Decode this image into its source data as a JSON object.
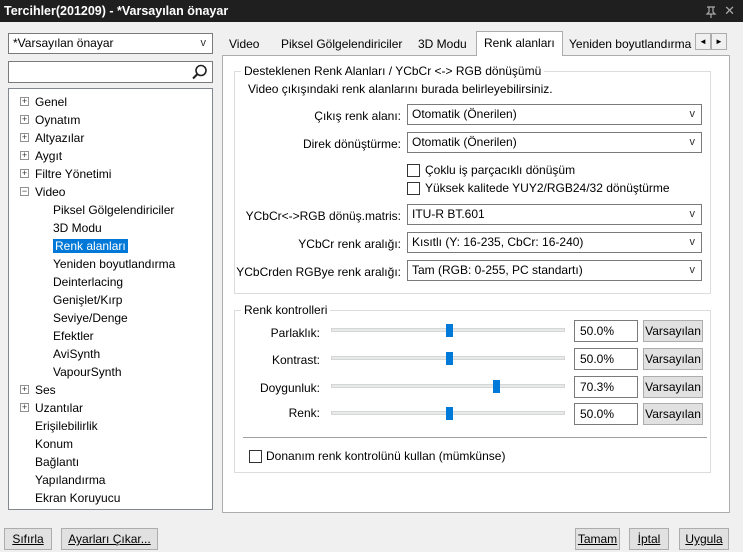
{
  "window": {
    "title": "Tercihler(201209) - *Varsayılan önayar",
    "pin_icon": "pin-icon",
    "close_icon": "close-icon"
  },
  "preset": {
    "value": "*Varsayılan önayar"
  },
  "search": {
    "value": "",
    "placeholder": ""
  },
  "tree": {
    "items": [
      {
        "label": "Genel",
        "expander": "+"
      },
      {
        "label": "Oynatım",
        "expander": "+"
      },
      {
        "label": "Altyazılar",
        "expander": "+"
      },
      {
        "label": "Aygıt",
        "expander": "+"
      },
      {
        "label": "Filtre Yönetimi",
        "expander": "+"
      },
      {
        "label": "Video",
        "expander": "−"
      },
      {
        "label": "Piksel Gölgelendiriciler"
      },
      {
        "label": "3D Modu"
      },
      {
        "label": "Renk alanları"
      },
      {
        "label": "Yeniden boyutlandırma"
      },
      {
        "label": "Deinterlacing"
      },
      {
        "label": "Genişlet/Kırp"
      },
      {
        "label": "Seviye/Denge"
      },
      {
        "label": "Efektler"
      },
      {
        "label": "AviSynth"
      },
      {
        "label": "VapourSynth"
      },
      {
        "label": "Ses",
        "expander": "+"
      },
      {
        "label": "Uzantılar",
        "expander": "+"
      },
      {
        "label": "Erişilebilirlik"
      },
      {
        "label": "Konum"
      },
      {
        "label": "Bağlantı"
      },
      {
        "label": "Yapılandırma"
      },
      {
        "label": "Ekran Koruyucu"
      }
    ],
    "selected": "Renk alanları"
  },
  "tabs": [
    {
      "label": "Video"
    },
    {
      "label": "Piksel Gölgelendiriciler"
    },
    {
      "label": "3D Modu"
    },
    {
      "label": "Renk alanları"
    },
    {
      "label": "Yeniden boyutlandırma"
    }
  ],
  "tab_scroll": {
    "left": "◄",
    "right": "►"
  },
  "colorspace": {
    "title": "Desteklenen Renk Alanları / YCbCr <-> RGB dönüşümü",
    "description": "Video çıkışındaki renk alanlarını burada belirleyebilirsiniz.",
    "output_label": "Çıkış renk alanı:",
    "output_value": "Otomatik (Önerilen)",
    "direct_label": "Direk dönüştürme:",
    "direct_value": "Otomatik (Önerilen)",
    "multithread_label": "Çoklu iş parçacıklı dönüşüm",
    "highquality_label": "Yüksek kalitede YUY2/RGB24/32 dönüştürme",
    "matrix_label": "YCbCr<->RGB dönüş.matris:",
    "matrix_value": "ITU-R BT.601",
    "ycbcr_range_label": "YCbCr renk aralığı:",
    "ycbcr_range_value": "Kısıtlı (Y: 16-235, CbCr: 16-240)",
    "rgb_range_label": "YCbCrden RGBye renk aralığı:",
    "rgb_range_value": "Tam (RGB: 0-255, PC standartı)"
  },
  "color_controls": {
    "title": "Renk kontrolleri",
    "brightness": {
      "label": "Parlaklık:",
      "value": "50.0%",
      "level": 0.5,
      "reset": "Varsayılan"
    },
    "contrast": {
      "label": "Kontrast:",
      "value": "50.0%",
      "level": 0.5,
      "reset": "Varsayılan"
    },
    "saturation": {
      "label": "Doygunluk:",
      "value": "70.3%",
      "level": 0.703,
      "reset": "Varsayılan"
    },
    "hue": {
      "label": "Renk:",
      "value": "50.0%",
      "level": 0.5,
      "reset": "Varsayılan"
    }
  },
  "hardware_control_label": "Donanım renk kontrolünü kullan (mümkünse)",
  "footer": {
    "reset": "Sıfırla",
    "export": "Ayarları Çıkar...",
    "ok": "Tamam",
    "cancel": "İptal",
    "apply": "Uygula"
  },
  "colors": {
    "accent": "#0078d7",
    "titlebar": "#1f1f1f",
    "slider_thumb": "#007ad9"
  }
}
